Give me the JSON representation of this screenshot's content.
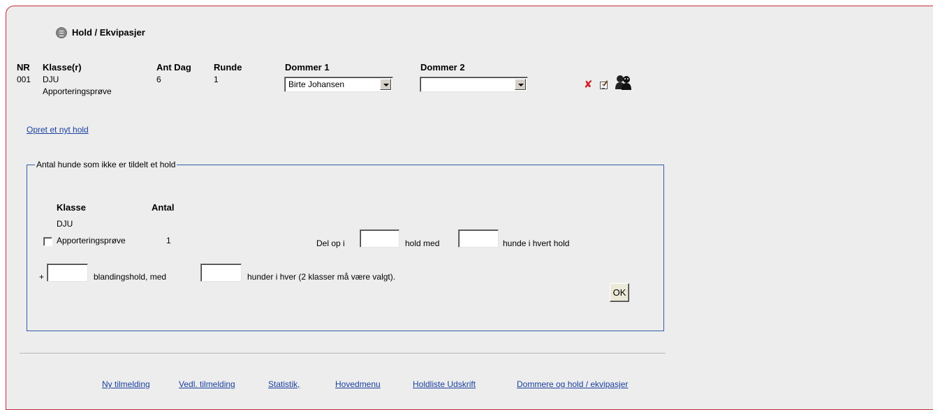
{
  "section": {
    "title": "Hold / Ekvipasjer",
    "icon": "list-icon"
  },
  "team_table": {
    "headers": {
      "nr": "NR",
      "klasse": "Klasse(r)",
      "ant_dag": "Ant Dag",
      "runde": "Runde",
      "dommer1": "Dommer 1",
      "dommer2": "Dommer 2"
    },
    "row": {
      "nr": "001",
      "klasse_line1": "DJU",
      "klasse_line2": "Apporteringsprøve",
      "ant_dag": "6",
      "runde": "1",
      "dommer1": "Birte Johansen",
      "dommer2": ""
    },
    "actions": [
      "delete-icon",
      "edit-icon",
      "people-icon"
    ]
  },
  "create_team_link": "Opret et nyt hold",
  "unassigned": {
    "legend": "Antal hunde som ikke er tildelt et hold",
    "headers": {
      "klasse": "Klasse",
      "antal": "Antal"
    },
    "row": {
      "klasse_line1": "DJU",
      "klasse_line2": "Apporteringsprøve",
      "antal": "1"
    },
    "split_prefix": "Del op i",
    "split_middle": "hold med",
    "split_suffix": "hunde i hvert hold",
    "mixed_prefix": "+",
    "mixed_middle": "blandingshold, med",
    "mixed_suffix": "hunder i hver (2 klasser må være valgt).",
    "ok_label": "OK"
  },
  "footer_links": [
    "Ny tilmelding",
    "Vedl. tilmelding",
    "Statistik,",
    "Hovedmenu",
    "Holdliste Udskrift",
    "Dommere og hold / ekvipasjer"
  ],
  "colors": {
    "panel_bg": "#ededed",
    "panel_border": "#c8283a",
    "fieldset_border": "#2e5ea3",
    "link": "#1a3f9e"
  }
}
